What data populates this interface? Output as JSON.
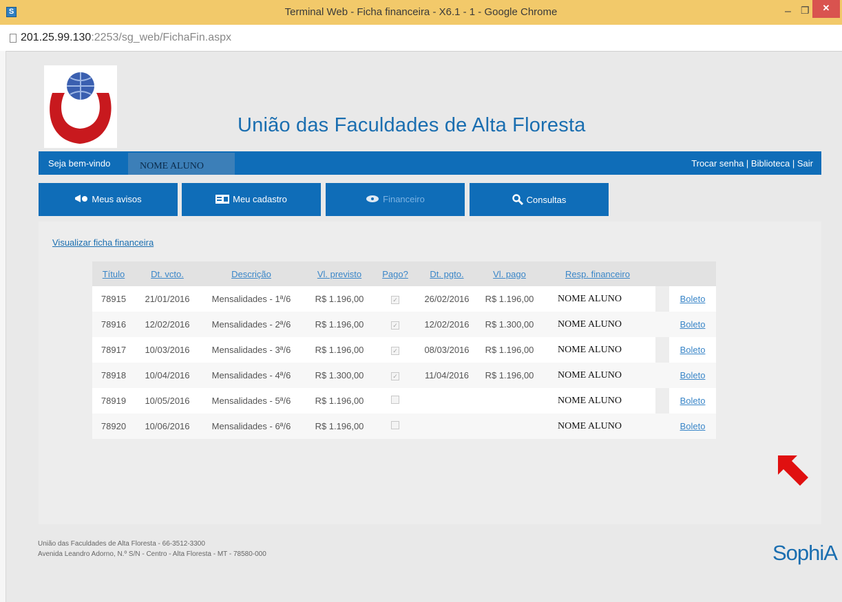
{
  "window": {
    "title": "Terminal Web - Ficha financeira - X6.1 - 1 - Google Chrome",
    "app_icon": "S"
  },
  "address": {
    "host": "201.25.99.130",
    "path": ":2253/sg_web/FichaFin.aspx"
  },
  "header": {
    "title": "União das Faculdades de Alta Floresta"
  },
  "userbar": {
    "welcome": "Seja bem-vindo",
    "name": "NOME ALUNO",
    "links": "Trocar senha | Biblioteca | Sair"
  },
  "nav": [
    {
      "label": "Meus avisos",
      "icon": "announcement-icon"
    },
    {
      "label": "Meu cadastro",
      "icon": "id-card-icon"
    },
    {
      "label": "Financeiro",
      "icon": "money-icon"
    },
    {
      "label": "Consultas",
      "icon": "search-icon"
    }
  ],
  "main": {
    "view_link": "Visualizar ficha financeira",
    "columns": [
      "Título",
      "Dt. vcto.",
      "Descrição",
      "Vl. previsto",
      "Pago?",
      "Dt. pgto.",
      "Vl. pago",
      "Resp. financeiro"
    ],
    "rows": [
      {
        "titulo": "78915",
        "vcto": "21/01/2016",
        "descricao": "Mensalidades - 1ª/6",
        "previsto": "R$ 1.196,00",
        "pago": true,
        "pgto": "26/02/2016",
        "vlpago": "R$ 1.196,00",
        "resp": "NOME ALUNO",
        "action": "Boleto"
      },
      {
        "titulo": "78916",
        "vcto": "12/02/2016",
        "descricao": "Mensalidades - 2ª/6",
        "previsto": "R$ 1.196,00",
        "pago": true,
        "pgto": "12/02/2016",
        "vlpago": "R$ 1.300,00",
        "resp": "NOME ALUNO",
        "action": "Boleto"
      },
      {
        "titulo": "78917",
        "vcto": "10/03/2016",
        "descricao": "Mensalidades - 3ª/6",
        "previsto": "R$ 1.196,00",
        "pago": true,
        "pgto": "08/03/2016",
        "vlpago": "R$ 1.196,00",
        "resp": "NOME ALUNO",
        "action": "Boleto"
      },
      {
        "titulo": "78918",
        "vcto": "10/04/2016",
        "descricao": "Mensalidades - 4ª/6",
        "previsto": "R$ 1.300,00",
        "pago": true,
        "pgto": "11/04/2016",
        "vlpago": "R$ 1.196,00",
        "resp": "NOME ALUNO",
        "action": "Boleto"
      },
      {
        "titulo": "78919",
        "vcto": "10/05/2016",
        "descricao": "Mensalidades - 5ª/6",
        "previsto": "R$ 1.196,00",
        "pago": false,
        "pgto": "",
        "vlpago": "",
        "resp": "NOME ALUNO",
        "action": "Boleto"
      },
      {
        "titulo": "78920",
        "vcto": "10/06/2016",
        "descricao": "Mensalidades - 6ª/6",
        "previsto": "R$ 1.196,00",
        "pago": false,
        "pgto": "",
        "vlpago": "",
        "resp": "NOME ALUNO",
        "action": "Boleto"
      }
    ]
  },
  "footer": {
    "line1": "União das Faculdades de Alta Floresta - 66-3512-3300",
    "line2": "Avenida Leandro Adorno, N.º S/N - Centro - Alta Floresta - MT - 78580-000",
    "brand": "SophiA"
  },
  "colors": {
    "brand_blue": "#0f6db8",
    "arrow_red": "#e01010",
    "titlebar": "#f2c96a"
  }
}
